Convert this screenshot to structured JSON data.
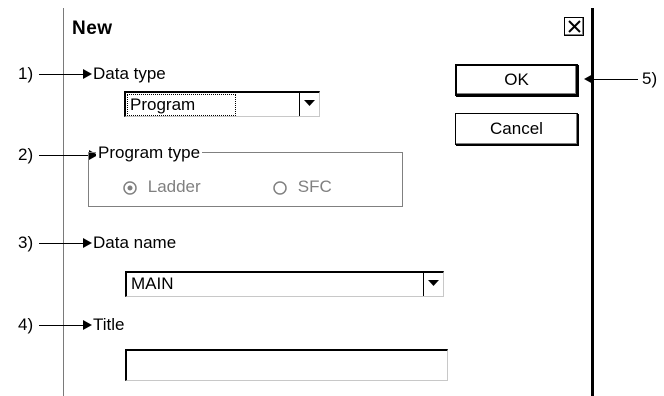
{
  "window": {
    "title": "New"
  },
  "callouts": {
    "one": "1)",
    "two": "2)",
    "three": "3)",
    "four": "4)",
    "five": "5)"
  },
  "data_type": {
    "label": "Data type",
    "selected": "Program"
  },
  "program_type": {
    "label": "Program type",
    "options": [
      {
        "label": "Ladder",
        "checked": true
      },
      {
        "label": "SFC",
        "checked": false
      }
    ]
  },
  "data_name": {
    "label": "Data name",
    "selected": "MAIN"
  },
  "title_field": {
    "label": "Title",
    "value": ""
  },
  "buttons": {
    "ok": "OK",
    "cancel": "Cancel"
  }
}
